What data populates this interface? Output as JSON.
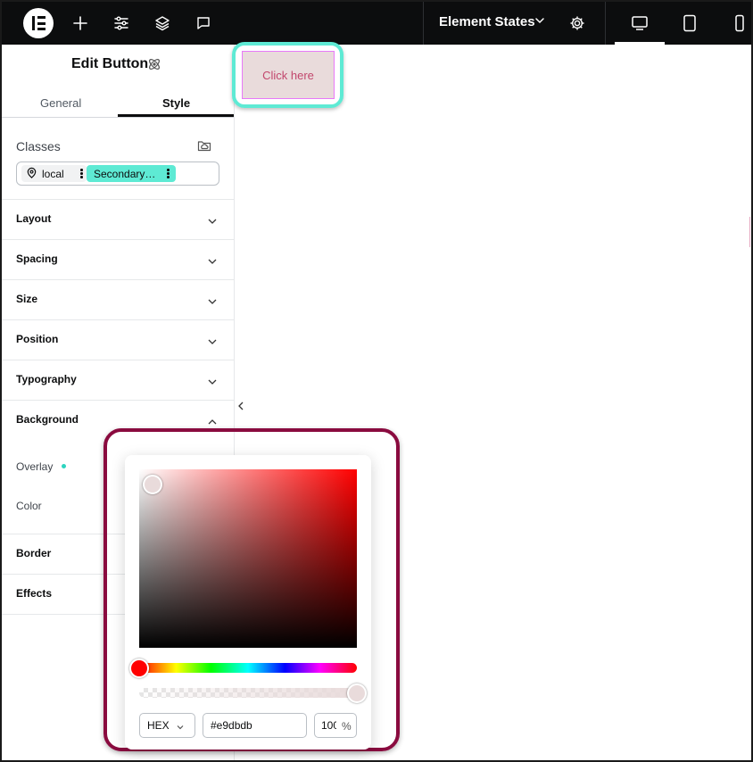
{
  "topbar": {
    "element_states_label": "Element States",
    "icons": [
      "elementor-logo-icon",
      "plus-icon",
      "sliders-icon",
      "layers-icon",
      "comment-icon",
      "chevron-down-icon",
      "gear-icon",
      "desktop-icon",
      "tablet-icon",
      "mobile-icon"
    ],
    "active_device": "desktop"
  },
  "panel": {
    "title": "Edit Button",
    "tabs": [
      {
        "label": "General",
        "active": false
      },
      {
        "label": "Style",
        "active": true
      }
    ],
    "classes": {
      "label": "Classes",
      "chips": [
        {
          "label": "local"
        },
        {
          "label": "Secondary…"
        }
      ]
    },
    "sections": [
      {
        "label": "Layout",
        "expanded": false
      },
      {
        "label": "Spacing",
        "expanded": false
      },
      {
        "label": "Size",
        "expanded": false
      },
      {
        "label": "Position",
        "expanded": false
      },
      {
        "label": "Typography",
        "expanded": false
      },
      {
        "label": "Background",
        "expanded": true
      },
      {
        "label": "Border",
        "expanded": false
      },
      {
        "label": "Effects",
        "expanded": false
      }
    ],
    "background_fields": {
      "overlay_label": "Overlay",
      "color_label": "Color"
    }
  },
  "canvas": {
    "button_text": "Click here",
    "button_color": "#e9dbdb",
    "highlight_color": "#5eead4"
  },
  "color_picker": {
    "format": "HEX",
    "hex_value": "#e9dbdb",
    "alpha_value": "100",
    "alpha_unit": "%",
    "hue_color": "#ff0000",
    "highlight_color": "#8a0b3f"
  }
}
